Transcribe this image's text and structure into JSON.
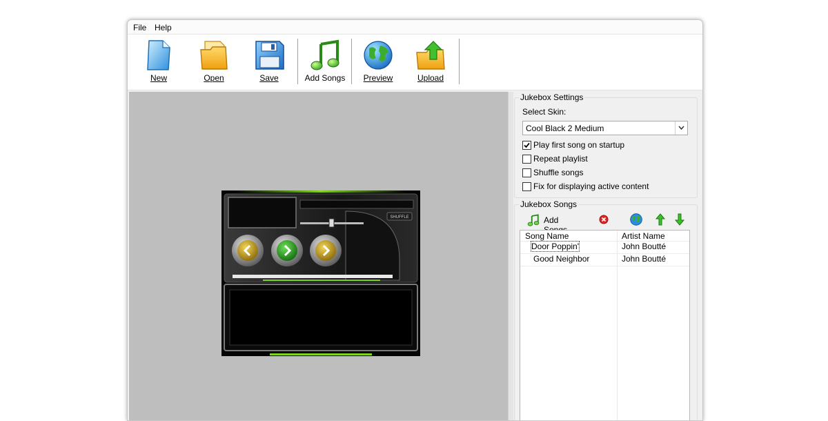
{
  "menu": {
    "file": "File",
    "help": "Help"
  },
  "toolbar": {
    "new": "New",
    "open": "Open",
    "save": "Save",
    "add_songs": "Add Songs",
    "preview": "Preview",
    "upload": "Upload"
  },
  "jukebox_preview": {
    "shuffle_label": "SHUFFLE"
  },
  "settings": {
    "title": "Jukebox Settings",
    "select_skin_label": "Select Skin:",
    "skin_value": "Cool Black 2 Medium",
    "options": [
      {
        "label": "Play first song on startup",
        "checked": true
      },
      {
        "label": "Repeat playlist",
        "checked": false
      },
      {
        "label": "Shuffle songs",
        "checked": false
      },
      {
        "label": "Fix for displaying active content",
        "checked": false
      }
    ]
  },
  "songs": {
    "title": "Jukebox Songs",
    "add_label": "Add Songs",
    "columns": [
      "Song Name",
      "Artist Name"
    ],
    "rows": [
      {
        "song": "Door Poppin'",
        "artist": "John Boutté"
      },
      {
        "song": "Good Neighbor",
        "artist": "John Boutté"
      }
    ]
  },
  "colors": {
    "preview_bg": "#bebebe",
    "jukebox_accent": "#7fd321",
    "play_green": "#2fa52a",
    "nav_gold": "#c49a12"
  }
}
